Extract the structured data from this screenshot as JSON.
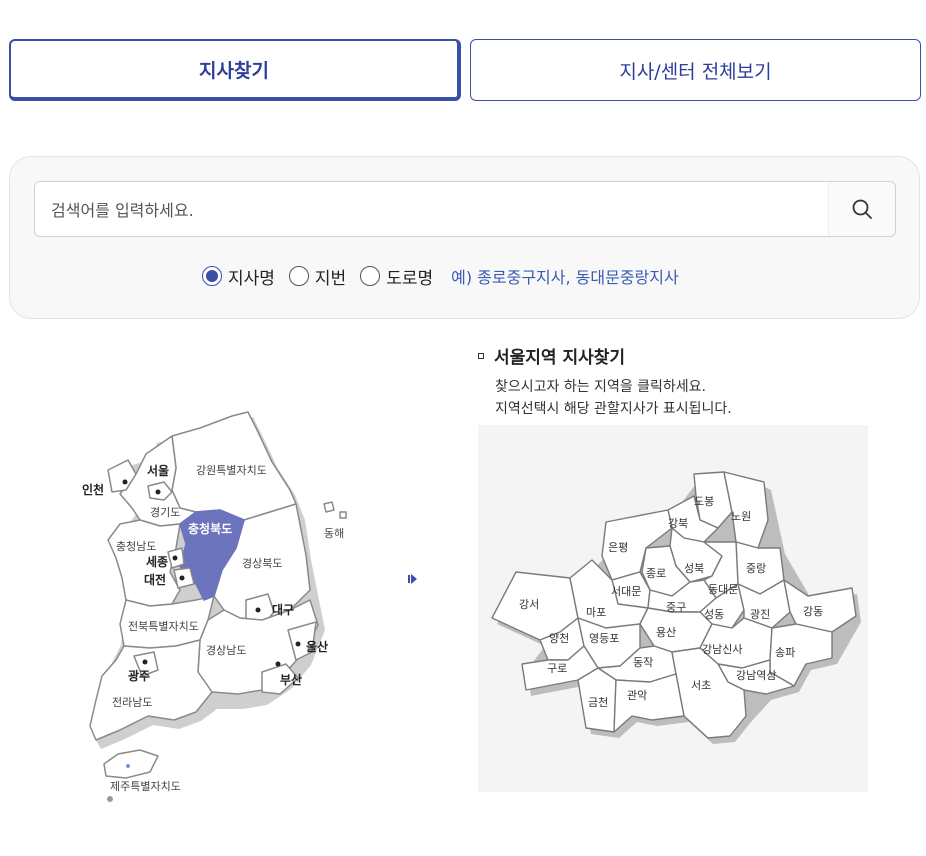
{
  "tabs": {
    "find_branch": "지사찾기",
    "view_all": "지사/센터 전체보기"
  },
  "search": {
    "placeholder": "검색어를 입력하세요.",
    "value": ""
  },
  "radios": [
    {
      "label": "지사명",
      "checked": true
    },
    {
      "label": "지번",
      "checked": false
    },
    {
      "label": "도로명",
      "checked": false
    }
  ],
  "example_text": "예) 종로중구지사, 동대문중랑지사",
  "korea_map": {
    "regions": {
      "gangwon": "강원특별자치도",
      "gyeonggi": "경기도",
      "chungbuk": "충청북도",
      "chungnam": "충청남도",
      "gyeongbuk": "경상북도",
      "jeonbuk": "전북특별자치도",
      "gyeongnam": "경상남도",
      "jeonnam": "전라남도",
      "jeju": "제주특별자치도",
      "donghae": "동해"
    },
    "cities": {
      "seoul": "서울",
      "incheon": "인천",
      "sejong": "세종",
      "daejeon": "대전",
      "daegu": "대구",
      "ulsan": "울산",
      "busan": "부산",
      "gwangju": "광주"
    },
    "selected_color": "#6b74bd"
  },
  "seoul": {
    "heading": "서울지역 지사찾기",
    "desc1": "찾으시고자 하는 지역을 클릭하세요.",
    "desc2": "지역선택시 해당 관할지사가 표시됩니다.",
    "districts": {
      "dobong": "도봉",
      "nowon": "노원",
      "gangbuk": "강북",
      "eunpyeong": "은평",
      "seongbuk": "성북",
      "jungnang": "중랑",
      "jongno": "종로",
      "dongdaemun": "동대문",
      "seodaemun": "서대문",
      "gangseo": "강서",
      "mapo": "마포",
      "junggu": "중구",
      "seongdong": "성동",
      "gwangjin": "광진",
      "gangdong": "강동",
      "yangcheon": "양천",
      "yeongdeungpo": "영등포",
      "yongsan": "용산",
      "gangnam": "강남신사",
      "songpa": "송파",
      "guro": "구로",
      "dongjak": "동작",
      "gangnamyeoksam": "강남역삼",
      "seocho": "서초",
      "geumcheon": "금천",
      "gwanak": "관악"
    }
  },
  "colors": {
    "accent": "#3b4fa8",
    "example_link": "#3b5bb5"
  }
}
